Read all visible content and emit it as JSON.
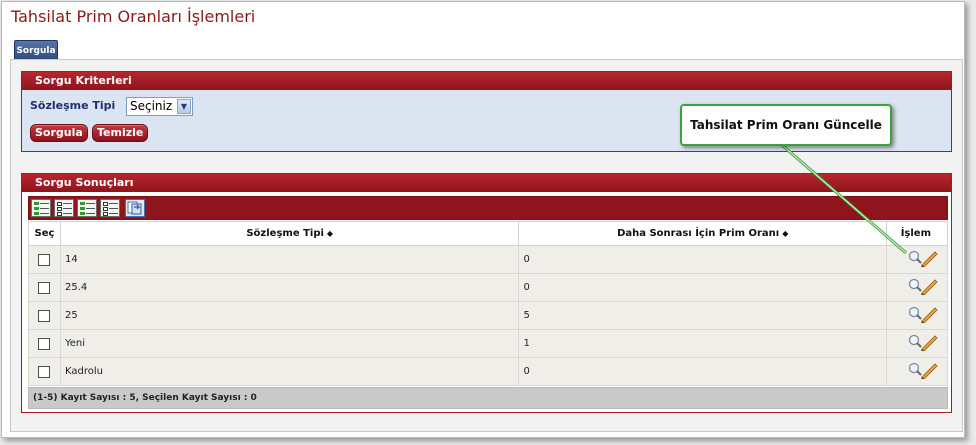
{
  "page": {
    "title": "Tahsilat Prim Oranları İşlemleri"
  },
  "tabs": [
    {
      "label": "Sorgula",
      "active": true
    }
  ],
  "criteria": {
    "header": "Sorgu Kriterleri",
    "contract_type_label": "Sözleşme Tipi",
    "contract_type_value": "Seçiniz",
    "query_button": "Sorgula",
    "clear_button": "Temizle"
  },
  "results": {
    "header": "Sorgu Sonuçları",
    "columns": {
      "select": "Seç",
      "contract_type": "Sözleşme Tipi",
      "next_rate": "Daha Sonrası İçin Prim Oranı",
      "action": "İşlem"
    },
    "sort_glyph": "◆",
    "rows": [
      {
        "contract_type": "14",
        "next_rate": "0"
      },
      {
        "contract_type": "25.4",
        "next_rate": "0"
      },
      {
        "contract_type": "25",
        "next_rate": "5"
      },
      {
        "contract_type": "Yeni",
        "next_rate": "1"
      },
      {
        "contract_type": "Kadrolu",
        "next_rate": "0"
      }
    ],
    "footer": "(1-5) Kayıt Sayısı : 5, Seçilen Kayıt Sayısı : 0"
  },
  "callout": {
    "text": "Tahsilat Prim Oranı Güncelle"
  },
  "colors": {
    "title": "#8b1a1a",
    "panel_header": "#a11c23",
    "criteria_bg": "#dbe5f1",
    "tab": "#2e4a7e",
    "callout_border": "#3aa537"
  },
  "icons": {
    "toolbar": [
      "select-all-icon",
      "deselect-all-icon",
      "select-page-icon",
      "deselect-page-icon",
      "export-icon"
    ],
    "row_action": "magnifier-pencil-icon"
  }
}
